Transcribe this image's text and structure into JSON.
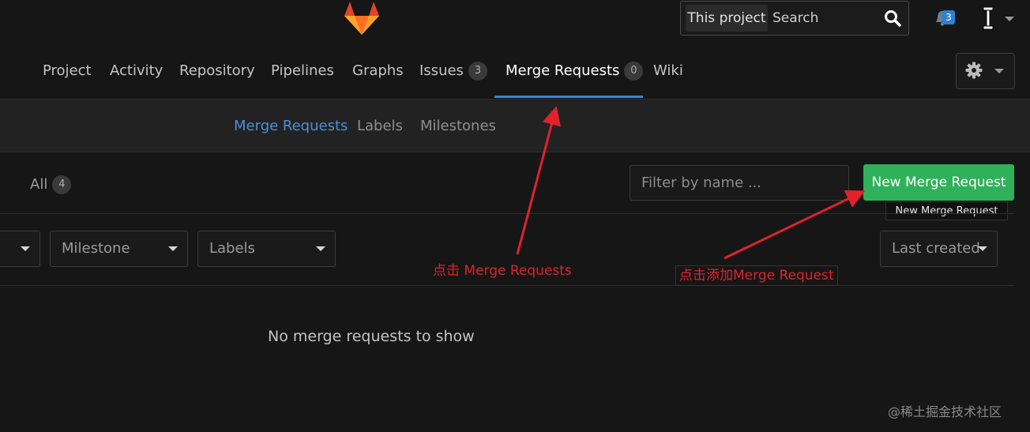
{
  "header": {
    "search": {
      "scope_label": "This project",
      "placeholder": "Search"
    },
    "notifications_count": "3"
  },
  "nav": {
    "items": [
      {
        "label": "Project"
      },
      {
        "label": "Activity"
      },
      {
        "label": "Repository"
      },
      {
        "label": "Pipelines"
      },
      {
        "label": "Graphs"
      },
      {
        "label": "Issues",
        "count": "3"
      },
      {
        "label": "Merge Requests",
        "count": "0",
        "active": true
      },
      {
        "label": "Wiki"
      }
    ]
  },
  "subnav": {
    "items": [
      {
        "label": "Merge Requests",
        "active": true
      },
      {
        "label": "Labels"
      },
      {
        "label": "Milestones"
      }
    ]
  },
  "toolbar": {
    "tab_all_label": "All",
    "tab_all_count": "4",
    "filter_placeholder": "Filter by name ...",
    "new_mr_label": "New Merge Request",
    "tooltip": "New Merge Request"
  },
  "filters": {
    "milestone_label": "Milestone",
    "labels_label": "Labels",
    "sort_label": "Last created"
  },
  "main": {
    "empty_message": "No merge requests to show"
  },
  "annotations": {
    "anno_1": "点击 Merge Requests",
    "anno_2": "点击添加Merge Request"
  },
  "watermark": "@稀土掘金技术社区",
  "colors": {
    "accent": "#3e83d2",
    "primary_button": "#2fb05a",
    "annotation": "#e0222a",
    "background": "#161616"
  }
}
